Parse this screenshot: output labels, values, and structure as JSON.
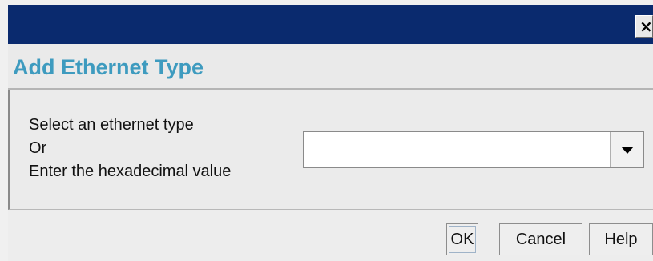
{
  "window": {
    "close_glyph": "×"
  },
  "header": {
    "title": "Add Ethernet Type"
  },
  "form": {
    "prompt_line1": "Select an ethernet type",
    "prompt_line2": "Or",
    "prompt_line3": "Enter the hexadecimal value",
    "ethernet_type_value": ""
  },
  "buttons": {
    "ok": "OK",
    "cancel": "Cancel",
    "help": "Help"
  },
  "icons": {
    "close": "close-icon",
    "dropdown": "chevron-down-icon"
  }
}
